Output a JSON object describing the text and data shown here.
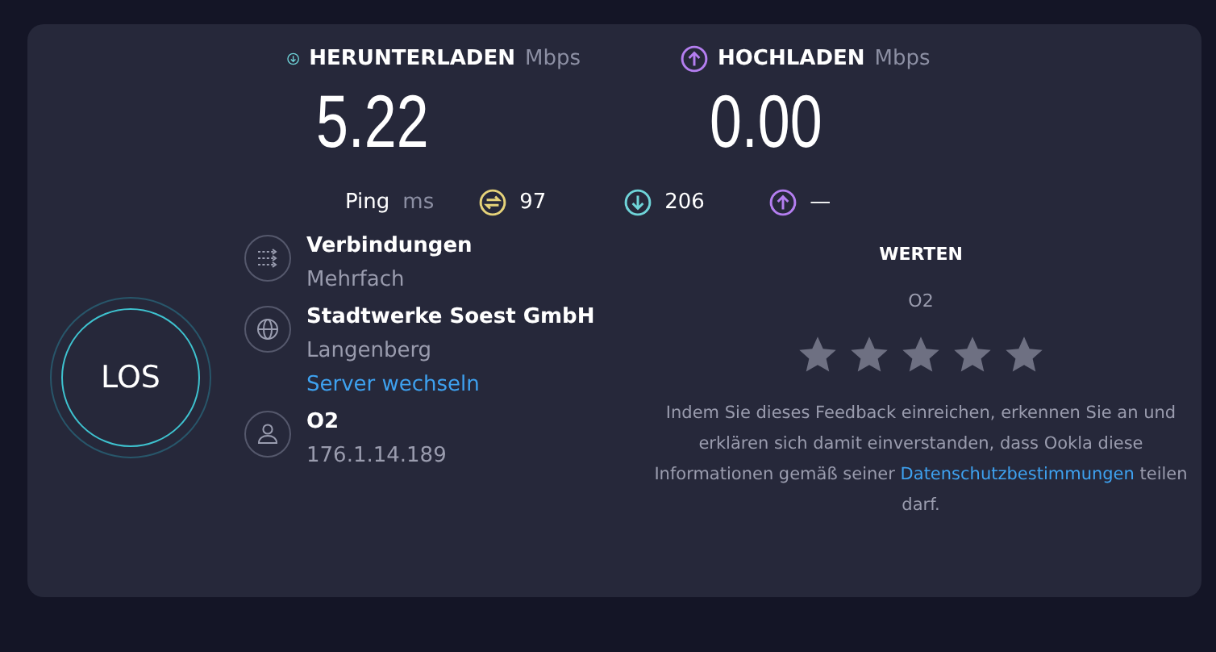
{
  "results": [
    {
      "kind": "download",
      "label": "HERUNTERLADEN",
      "unit": "Mbps",
      "value": "5.22"
    },
    {
      "kind": "upload",
      "label": "HOCHLADEN",
      "unit": "Mbps",
      "value": "0.00"
    }
  ],
  "ping": {
    "label": "Ping",
    "unit": "ms",
    "items": [
      {
        "kind": "idle",
        "value": "97"
      },
      {
        "kind": "download",
        "value": "206"
      },
      {
        "kind": "upload",
        "value": "—"
      }
    ]
  },
  "go_button": {
    "label": "LOS"
  },
  "info": [
    {
      "kind": "connections",
      "title": "Verbindungen",
      "subtitle": "Mehrfach"
    },
    {
      "kind": "server",
      "title": "Stadtwerke Soest GmbH",
      "subtitle": "Langenberg",
      "link": "Server wechseln"
    },
    {
      "kind": "provider",
      "title": "O2",
      "subtitle": "176.1.14.189"
    }
  ],
  "rating": {
    "title": "WERTEN",
    "provider": "O2",
    "stars": 0,
    "notice_before": "Indem Sie dieses Feedback einreichen, erkennen Sie an und erklären sich damit einverstanden, dass Ookla diese Informationen gemäß seiner ",
    "notice_link": "Datenschutzbestimmungen",
    "notice_after": " teilen darf."
  }
}
